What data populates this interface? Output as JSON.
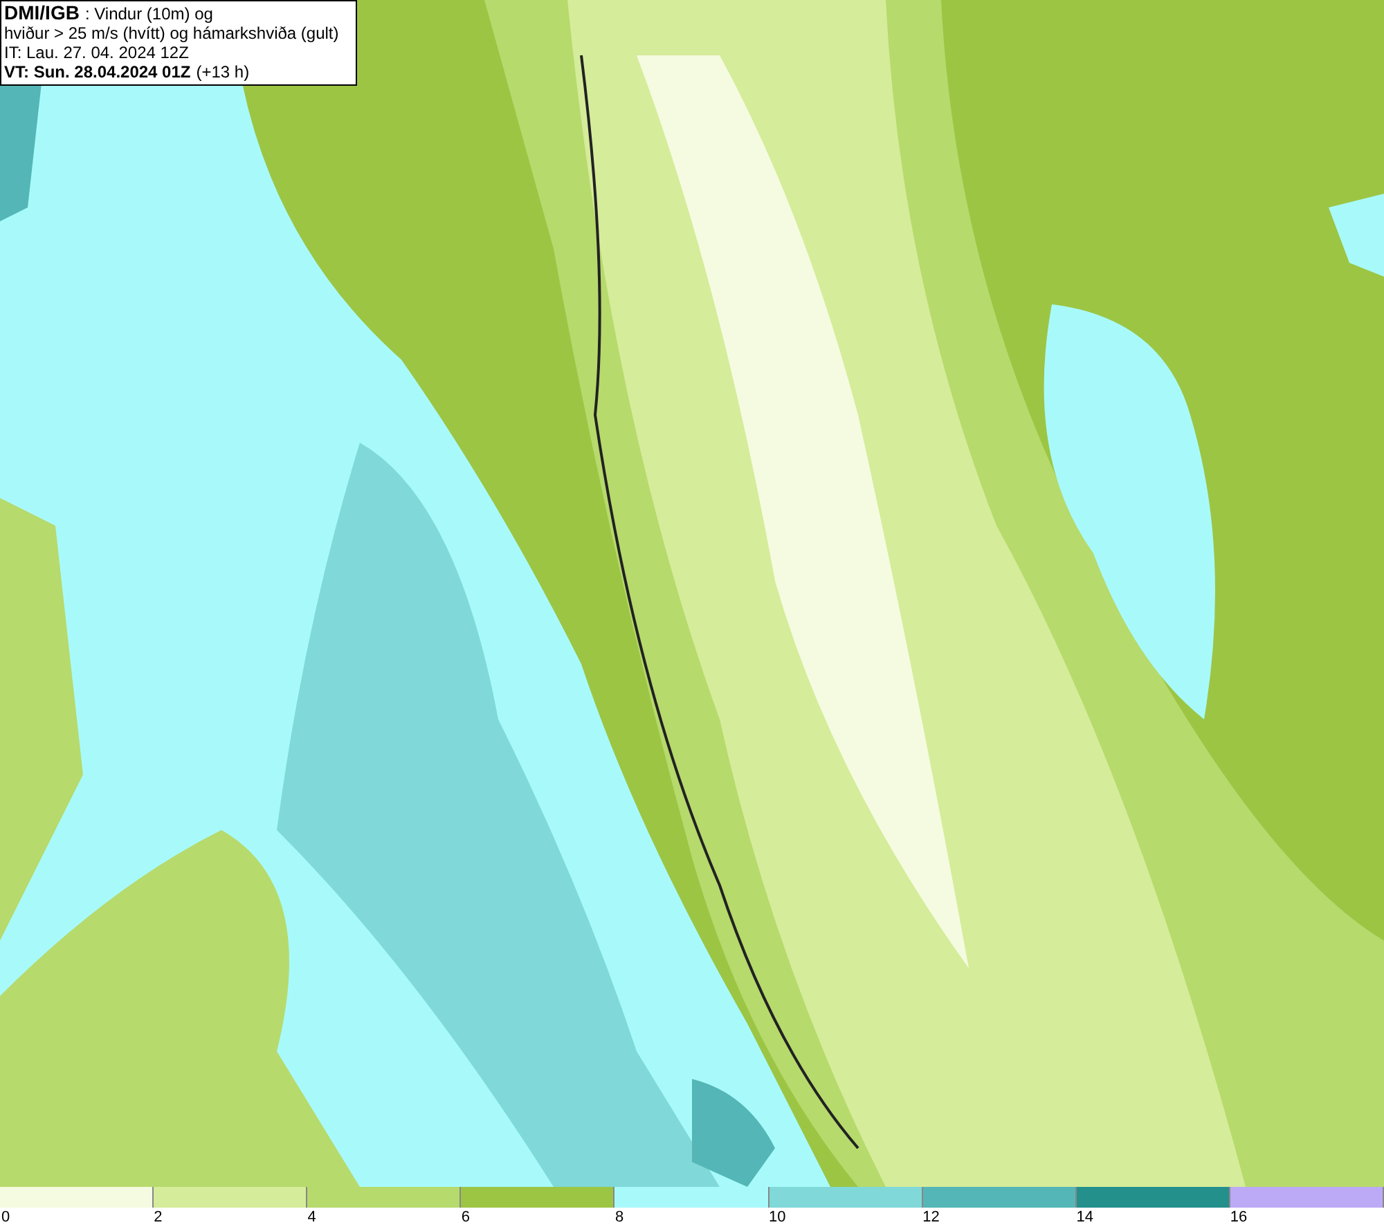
{
  "header": {
    "source": "DMI/IGB",
    "title": ": Vindur (10m) og",
    "subtitle": "hviður > 25 m/s (hvítt) og hámarkshviða (gult)",
    "issue_time": "IT: Lau. 27. 04. 2024 12Z",
    "valid_time": "VT: Sun. 28.04.2024 01Z",
    "lead_time": "(+13 h)"
  },
  "legend": {
    "bins": [
      {
        "color": "#f5fbe0"
      },
      {
        "color": "#d5ec9a"
      },
      {
        "color": "#b6da6c"
      },
      {
        "color": "#9cc544"
      },
      {
        "color": "#a8fafa"
      },
      {
        "color": "#80d8d8"
      },
      {
        "color": "#54b6b6"
      },
      {
        "color": "#23908c"
      },
      {
        "color": "#bcaaf6"
      }
    ],
    "ticks": [
      "0",
      "2",
      "4",
      "6",
      "8",
      "10",
      "12",
      "14",
      "16"
    ]
  }
}
